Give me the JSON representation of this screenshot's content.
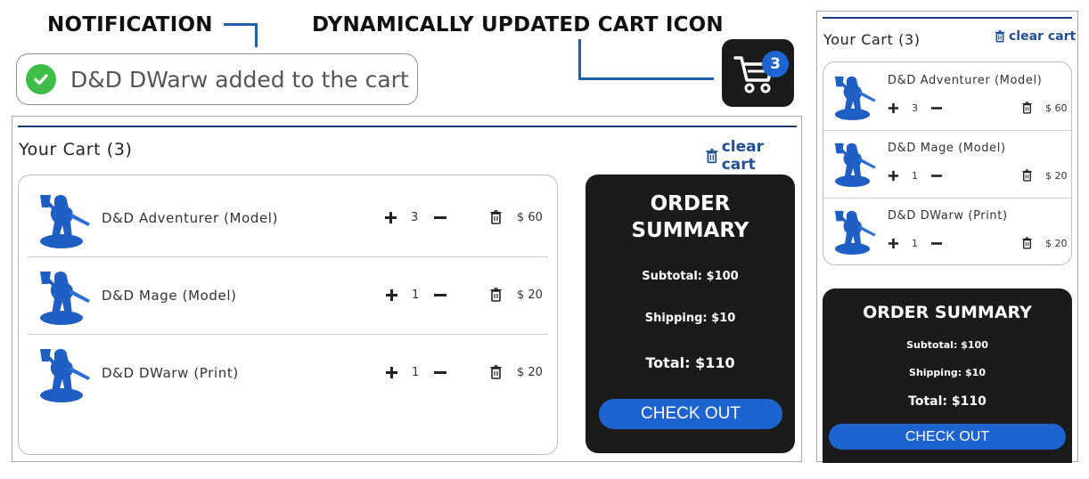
{
  "annotations": {
    "notification_label": "NOTIFICATION",
    "cart_icon_label": "DYNAMICALLY UPDATED CART ICON"
  },
  "notification": {
    "text": "D&D DWarw added to the cart",
    "icon": "check-circle-icon",
    "color": "#3fbd49"
  },
  "cart_icon": {
    "icon": "shopping-cart-icon",
    "count": "3",
    "badge_color": "#1d64d0"
  },
  "cart": {
    "title": "Your Cart (3)",
    "clear_label": "clear cart",
    "items": [
      {
        "name": "D&D Adventurer (Model)",
        "qty": "3",
        "price": "$ 60"
      },
      {
        "name": "D&D Mage (Model)",
        "qty": "1",
        "price": "$ 20"
      },
      {
        "name": "D&D DWarw (Print)",
        "qty": "1",
        "price": "$ 20"
      }
    ]
  },
  "summary": {
    "title_line1": "ORDER",
    "title_line2": "SUMMARY",
    "title_full": "ORDER SUMMARY",
    "subtotal": "Subtotal: $100",
    "shipping": "Shipping: $10",
    "total": "Total: $110",
    "checkout_label": "CHECK OUT"
  },
  "colors": {
    "accent_blue": "#1d64d0",
    "rule_navy": "#1b3d73",
    "summary_bg": "#1b1b1b",
    "figure_blue": "#1f5fc4"
  }
}
